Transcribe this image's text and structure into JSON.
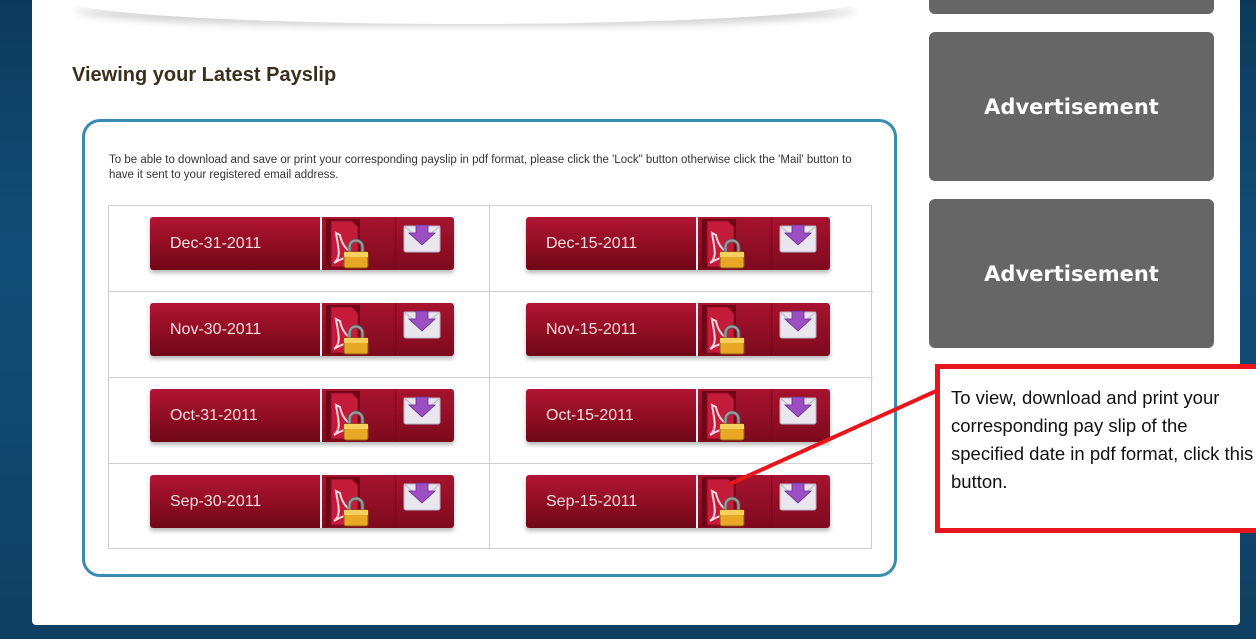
{
  "section": {
    "title": "Viewing your Latest Payslip",
    "instructions": "To be able to download and save or print your corresponding payslip in pdf format, please click the 'Lock\" button otherwise click the 'Mail' button to have it sent to your registered email address."
  },
  "payslips": [
    {
      "date": "Dec-31-2011"
    },
    {
      "date": "Dec-15-2011"
    },
    {
      "date": "Nov-30-2011"
    },
    {
      "date": "Nov-15-2011"
    },
    {
      "date": "Oct-31-2011"
    },
    {
      "date": "Oct-15-2011"
    },
    {
      "date": "Sep-30-2011"
    },
    {
      "date": "Sep-15-2011"
    }
  ],
  "ads": [
    {
      "label": "Advertisement"
    },
    {
      "label": "Advertisement"
    }
  ],
  "callout": {
    "text": "To view, download and print your corresponding pay slip of the specified date in pdf format, click this button."
  },
  "colors": {
    "button_red": "#9b0f27",
    "frame_blue": "#3a8bb0",
    "ad_gray": "#666666",
    "callout_red": "#e8161c"
  },
  "icons": {
    "lock": "pdf-lock-icon",
    "mail": "mail-download-icon"
  }
}
